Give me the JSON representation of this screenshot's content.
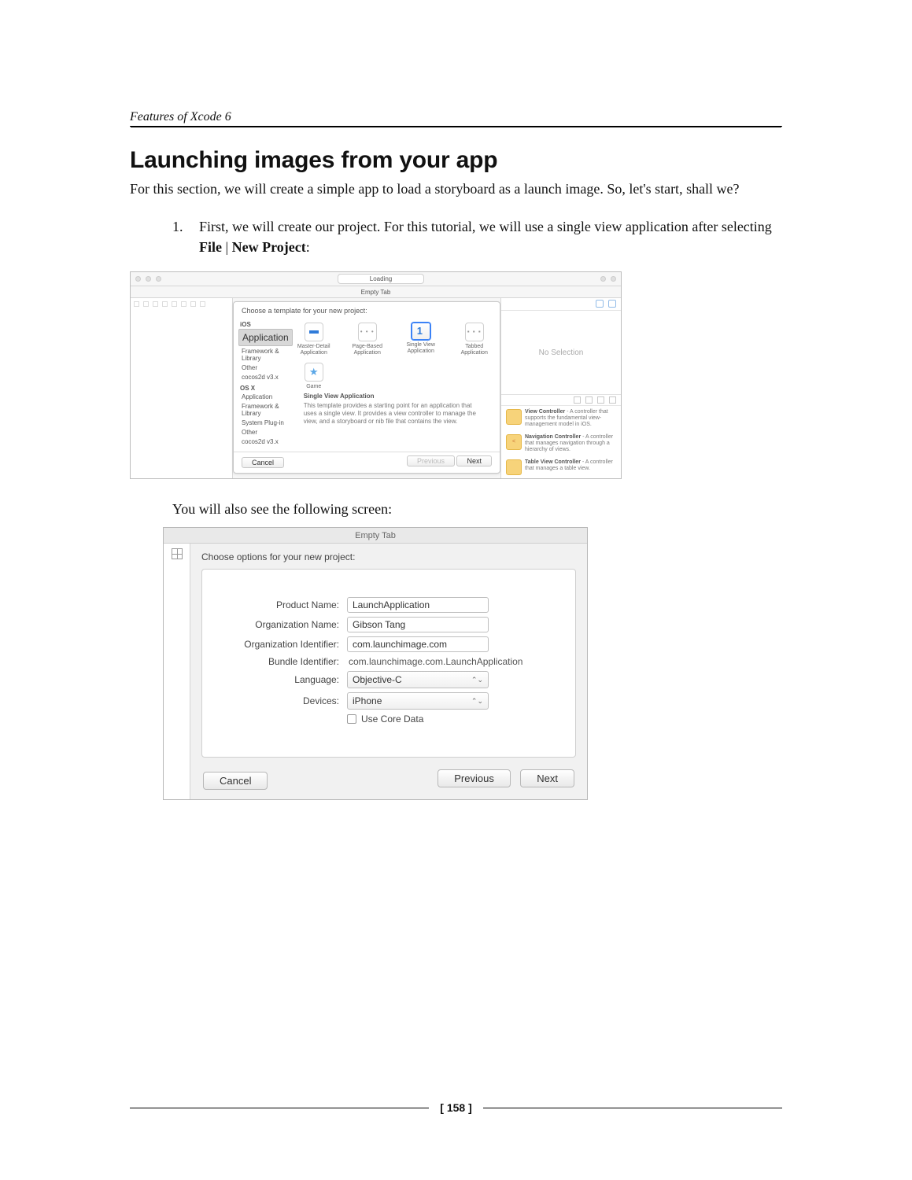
{
  "running_head": "Features of Xcode 6",
  "section_title": "Launching images from your app",
  "intro": "For this section, we will create a simple app to load a storyboard as a launch image. So, let's start, shall we?",
  "step1_num": "1.",
  "step1_a": "First, we will create our project. For this tutorial, we will use a single view application after selecting ",
  "step1_b": "File",
  "step1_sep": " | ",
  "step1_c": "New Project",
  "step1_colon": ":",
  "between": "You will also see the following screen:",
  "page_number": "[ 158 ]",
  "shot1": {
    "status": "Loading",
    "tab": "Empty Tab",
    "sheet_title": "Choose a template for your new project:",
    "sidebar": {
      "ios": "iOS",
      "ios_items": [
        "Application",
        "Framework & Library",
        "Other",
        "cocos2d v3.x"
      ],
      "osx": "OS X",
      "osx_items": [
        "Application",
        "Framework & Library",
        "System Plug-in",
        "Other",
        "cocos2d v3.x"
      ]
    },
    "tiles_row1": [
      {
        "name": "Master-Detail Application"
      },
      {
        "name": "Page-Based Application"
      },
      {
        "name": "Single View Application"
      },
      {
        "name": "Tabbed Application"
      }
    ],
    "tiles_row2": [
      {
        "name": "Game"
      }
    ],
    "desc_title": "Single View Application",
    "desc_body": "This template provides a starting point for an application that uses a single view. It provides a view controller to manage the view, and a storyboard or nib file that contains the view.",
    "buttons": {
      "cancel": "Cancel",
      "previous": "Previous",
      "next": "Next"
    },
    "inspector": {
      "no_selection": "No Selection",
      "lib": [
        {
          "title": "View Controller",
          "body": " - A controller that supports the fundamental view-management model in iOS."
        },
        {
          "title": "Navigation Controller",
          "body": " - A controller that manages navigation through a hierarchy of views."
        },
        {
          "title": "Table View Controller",
          "body": " - A controller that manages a table view."
        }
      ]
    }
  },
  "shot2": {
    "tab": "Empty Tab",
    "sheet_title": "Choose options for your new project:",
    "fields": {
      "product_name_label": "Product Name:",
      "product_name": "LaunchApplication",
      "org_name_label": "Organization Name:",
      "org_name": "Gibson Tang",
      "org_id_label": "Organization Identifier:",
      "org_id": "com.launchimage.com",
      "bundle_id_label": "Bundle Identifier:",
      "bundle_id": "com.launchimage.com.LaunchApplication",
      "language_label": "Language:",
      "language": "Objective-C",
      "devices_label": "Devices:",
      "devices": "iPhone",
      "coredata_label": "Use Core Data"
    },
    "buttons": {
      "cancel": "Cancel",
      "previous": "Previous",
      "next": "Next"
    }
  }
}
